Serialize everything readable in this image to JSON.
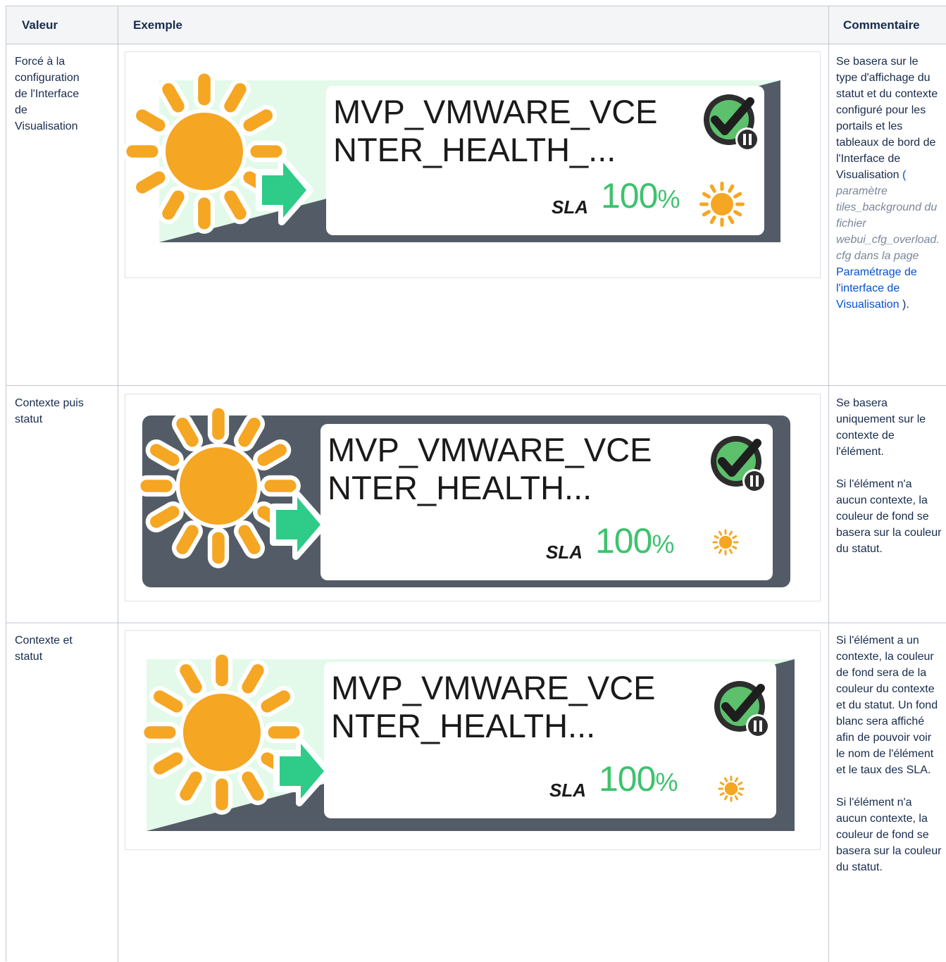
{
  "headers": {
    "value": "Valeur",
    "example": "Exemple",
    "comment": "Commentaire"
  },
  "rows": [
    {
      "value": "Forcé à la\nconfiguration\nde l'Interface\nde\nVisualisation",
      "tile": {
        "name": "MVP_VMWARE_VCE\nNTER_HEALTH_...",
        "sla_label": "SLA",
        "sla_value": "100",
        "sla_unit": "%",
        "style": "context-diagonal"
      },
      "comment": {
        "text": "Se basera sur le type d'affichage du statut et du contexte configuré pour les portails et les tableaux de bord de l'Interface de Visualisation",
        "open_paren": "(",
        "param_pre": "paramètre tiles_background du fichier webui_cfg_overload.cfg dans la page",
        "link": "Paramétrage de l'interface de Visualisation",
        "close": ")."
      }
    },
    {
      "value": "Contexte puis\nstatut",
      "tile": {
        "name": "MVP_VMWARE_VCE\nNTER_HEALTH...",
        "sla_label": "SLA",
        "sla_value": "100",
        "sla_unit": "%",
        "style": "context-full"
      },
      "comment": {
        "p1": "Se basera uniquement sur le contexte de l'élément.",
        "p2": "Si l'élément n'a aucun contexte, la couleur de fond se basera sur la couleur du statut."
      }
    },
    {
      "value": "Contexte et\nstatut",
      "tile": {
        "name": "MVP_VMWARE_VCE\nNTER_HEALTH...",
        "sla_label": "SLA",
        "sla_value": "100",
        "sla_unit": "%",
        "style": "context-diagonal"
      },
      "comment": {
        "p1": "Si l'élément a un contexte, la couleur de fond sera de la couleur du contexte et du statut. Un fond blanc sera affiché afin de pouvoir voir le nom de l'élément et le taux des SLA.",
        "p2": "Si l'élément n'a aucun contexte, la couleur de fond se basera sur la couleur du statut."
      }
    }
  ],
  "icons": {
    "weather": "sun-icon",
    "arrow": "arrow-right-icon",
    "check": "check-icon",
    "pause": "pause-icon"
  },
  "colors": {
    "context_dark": "#535c66",
    "status_light": "#e3faea",
    "sun": "#f5a623",
    "arrow": "#2ecc88",
    "sla": "#3ec26e"
  }
}
